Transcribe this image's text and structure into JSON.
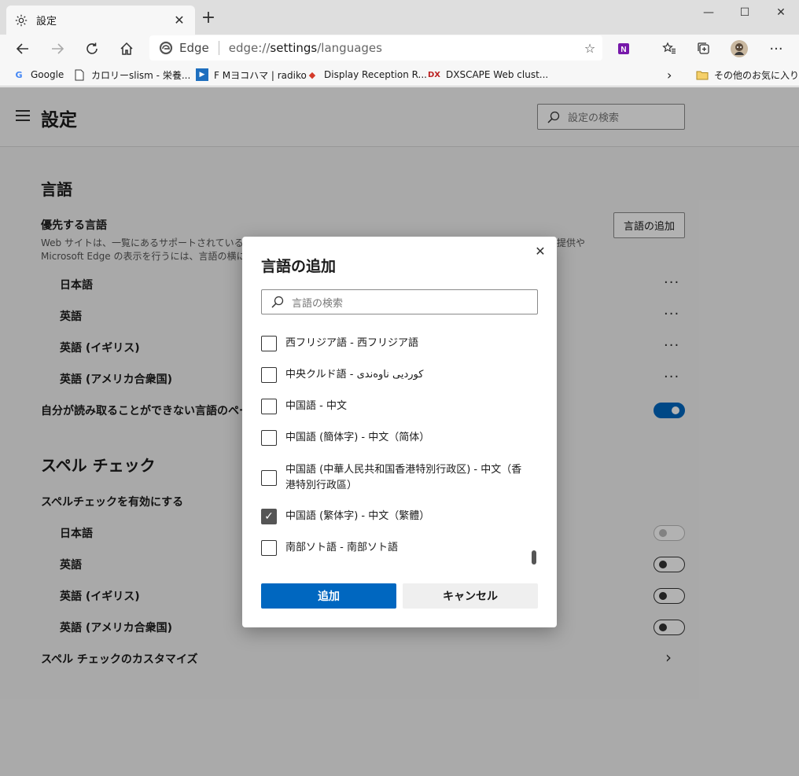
{
  "browser": {
    "tab_title": "設定",
    "address": {
      "brand": "Edge",
      "url_prefix": "edge://",
      "url_path": "settings",
      "url_suffix": "/languages"
    },
    "favorites": [
      {
        "icon": "google-icon",
        "label": "Google"
      },
      {
        "icon": "page-icon",
        "label": "カロリーslism - 栄養..."
      },
      {
        "icon": "radio-icon",
        "label": "F Mヨコハマ | radiko"
      },
      {
        "icon": "display-icon",
        "label": "Display Reception R..."
      },
      {
        "icon": "dx-icon",
        "label": "DXSCAPE Web clust..."
      }
    ],
    "other_favorites": "その他のお気に入り"
  },
  "settings": {
    "title": "設定",
    "search_placeholder": "設定の検索",
    "languages": {
      "heading": "言語",
      "preferred_heading": "優先する言語",
      "desc_line1": "Web サイトは、一覧にあるサポートされている言語のうち",
      "desc_line1_tail": "提供や",
      "desc_line2": "Microsoft Edge の表示を行うには、言語の横にある [",
      "add_button": "言語の追加",
      "items": [
        "日本語",
        "英語",
        "英語 (イギリス)",
        "英語 (アメリカ合衆国)"
      ],
      "translate_offer": "自分が読み取ることができない言語のページの翻"
    },
    "spellcheck": {
      "heading": "スペル チェック",
      "enable_label": "スペルチェックを有効にする",
      "items": [
        "日本語",
        "英語",
        "英語 (イギリス)",
        "英語 (アメリカ合衆国)"
      ],
      "customize": "スペル チェックのカスタマイズ"
    }
  },
  "dialog": {
    "title": "言語の追加",
    "search_placeholder": "言語の検索",
    "languages": [
      {
        "label": "西フリジア語 - 西フリジア語",
        "checked": false
      },
      {
        "label": "中央クルド語 - کوردیی ناوەندی",
        "checked": false
      },
      {
        "label": "中国語 - 中文",
        "checked": false
      },
      {
        "label": "中国語 (簡体字) - 中文（简体）",
        "checked": false
      },
      {
        "label": "中国語 (中華人民共和国香港特別行政区) - 中文（香港特別行政區）",
        "checked": false
      },
      {
        "label": "中国語 (繁体字) - 中文（繁體）",
        "checked": true
      },
      {
        "label": "南部ソト語 - 南部ソト語",
        "checked": false
      }
    ],
    "add_button": "追加",
    "cancel_button": "キャンセル"
  },
  "colors": {
    "accent": "#0067c0"
  }
}
